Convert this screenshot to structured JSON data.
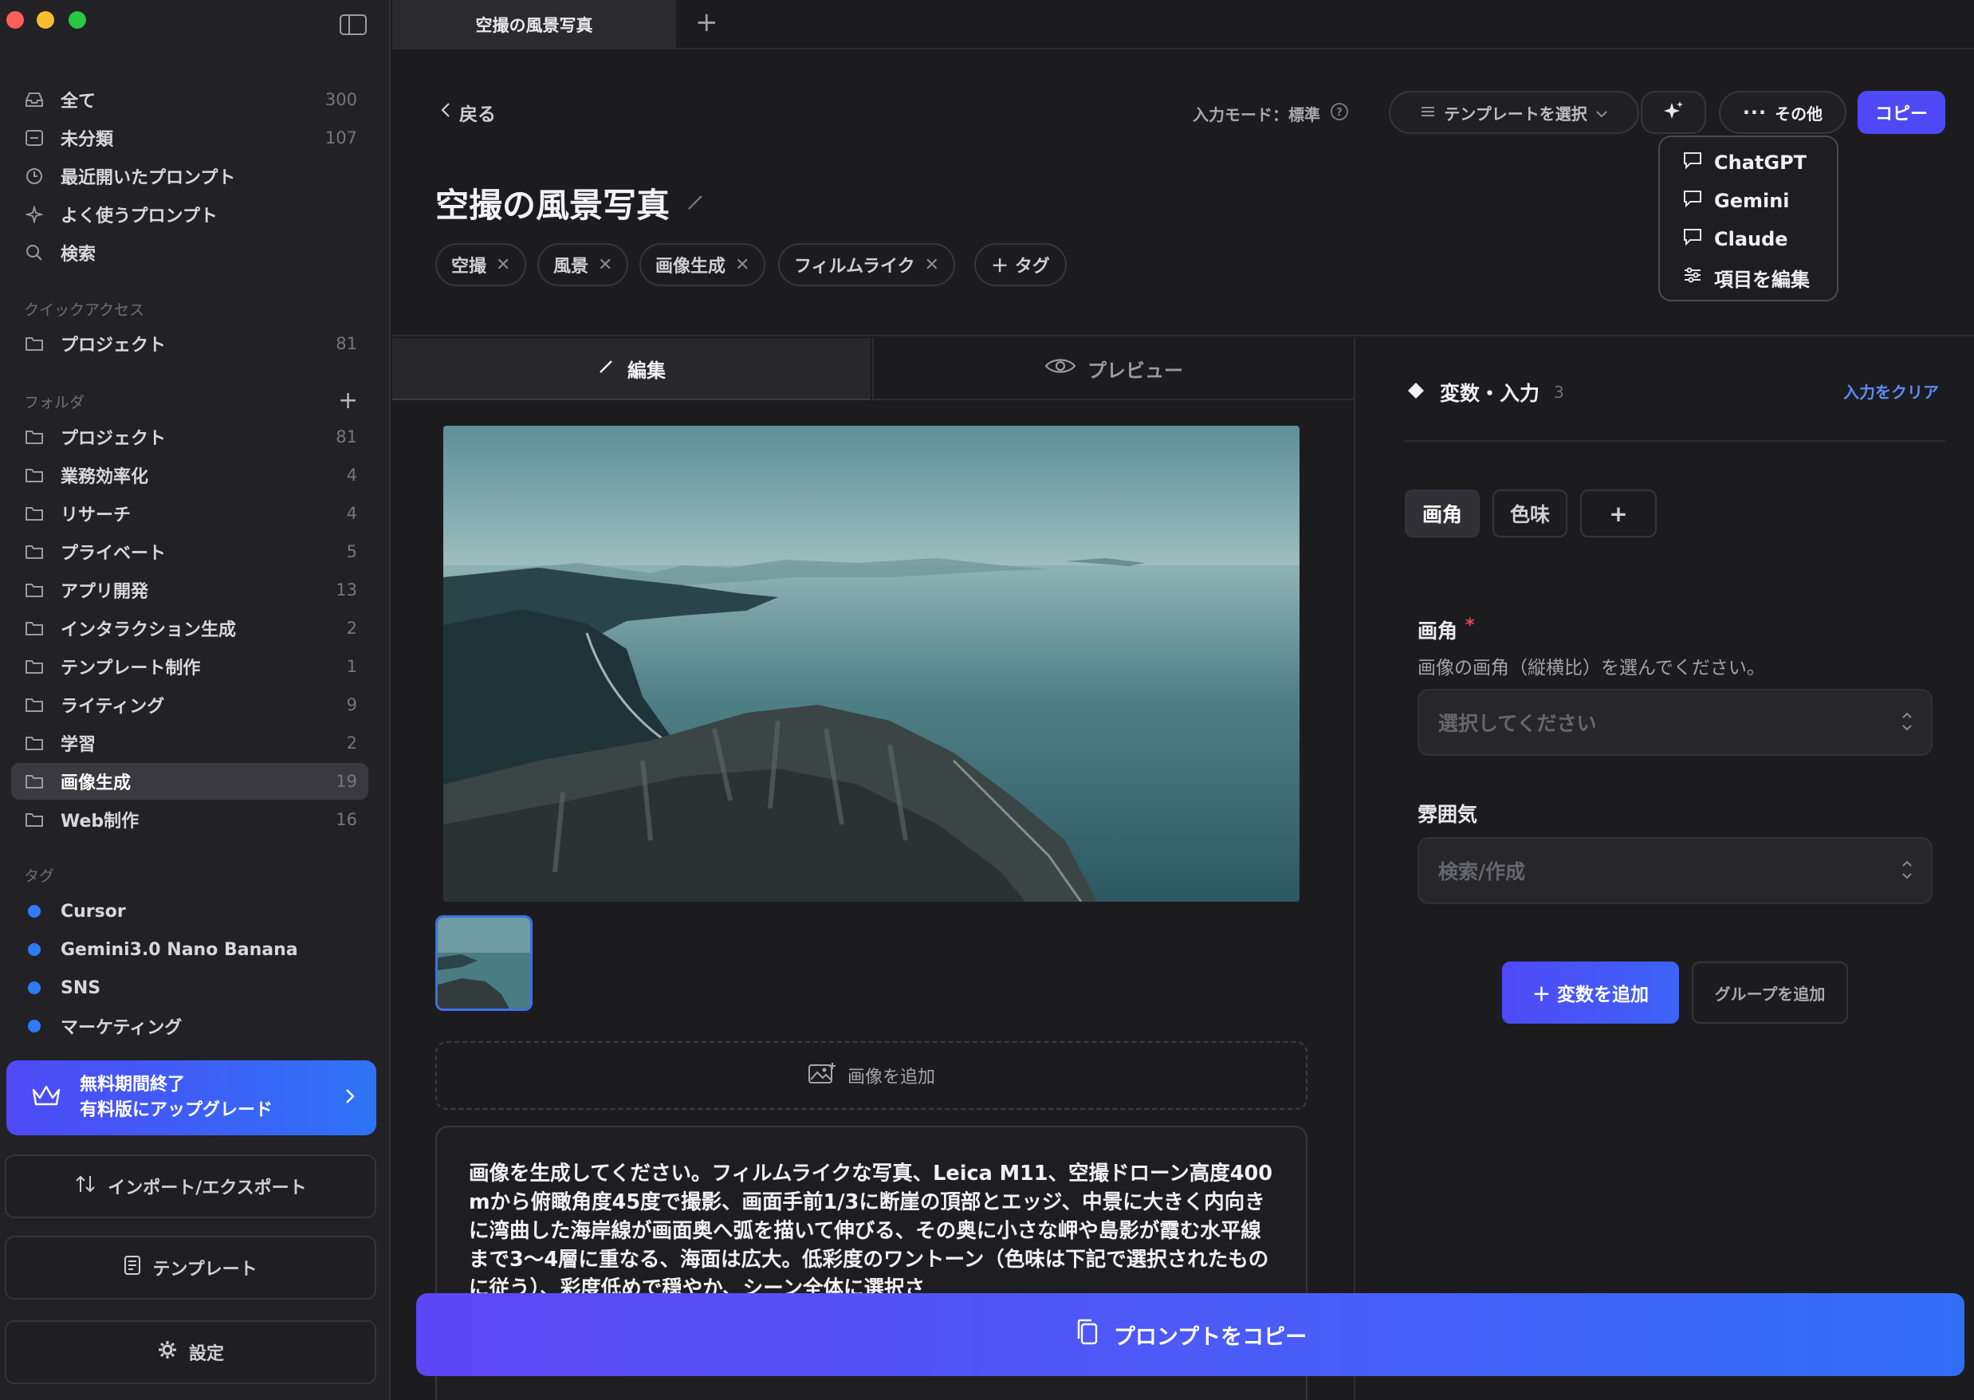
{
  "colors": {
    "accent": "#4f49f5",
    "accent_blue": "#316ef6",
    "required": "#e5484d",
    "tag_dot": "#2f7bf6",
    "link": "#5b8cf7"
  },
  "window": {
    "traffic_lights": [
      "close",
      "minimize",
      "zoom"
    ],
    "sidebar_toggle_icon": "sidebar-icon"
  },
  "sidebar": {
    "top_items": [
      {
        "label": "全て",
        "count": "300",
        "icon": "inbox-icon"
      },
      {
        "label": "未分類",
        "count": "107",
        "icon": "tray-icon"
      },
      {
        "label": "最近開いたプロンプト",
        "count": "",
        "icon": "clock-icon"
      },
      {
        "label": "よく使うプロンプト",
        "count": "",
        "icon": "sparkle-icon"
      },
      {
        "label": "検索",
        "count": "",
        "icon": "search-icon"
      }
    ],
    "quick_access_label": "クイックアクセス",
    "quick_access": [
      {
        "label": "プロジェクト",
        "count": "81"
      }
    ],
    "folders_label": "フォルダ",
    "folders": [
      {
        "label": "プロジェクト",
        "count": "81"
      },
      {
        "label": "業務効率化",
        "count": "4"
      },
      {
        "label": "リサーチ",
        "count": "4"
      },
      {
        "label": "プライベート",
        "count": "5"
      },
      {
        "label": "アプリ開発",
        "count": "13"
      },
      {
        "label": "インタラクション生成",
        "count": "2"
      },
      {
        "label": "テンプレート制作",
        "count": "1"
      },
      {
        "label": "ライティング",
        "count": "9"
      },
      {
        "label": "学習",
        "count": "2"
      },
      {
        "label": "画像生成",
        "count": "19"
      },
      {
        "label": "Web制作",
        "count": "16"
      }
    ],
    "active_folder": "画像生成",
    "tags_label": "タグ",
    "tags": [
      "Cursor",
      "Gemini3.0 Nano Banana",
      "SNS",
      "マーケティング"
    ],
    "upgrade": {
      "line1": "無料期間終了",
      "line2": "有料版にアップグレード"
    },
    "import_export": "インポート/エクスポート",
    "templates": "テンプレート",
    "settings": "設定"
  },
  "tabbar": {
    "tab_title": "空撮の風景写真",
    "new_tab": "+"
  },
  "toolbar": {
    "back": "戻る",
    "input_mode": "入力モード：標準",
    "template_select": "テンプレートを選択",
    "more": "その他",
    "copy": "コピー"
  },
  "dropdown": {
    "items": [
      "ChatGPT",
      "Gemini",
      "Claude",
      "項目を編集"
    ]
  },
  "prompt": {
    "title": "空撮の風景写真",
    "tags": [
      "空撮",
      "風景",
      "画像生成",
      "フィルムライク"
    ],
    "add_tag": "＋ タグ"
  },
  "editor": {
    "tab_edit": "編集",
    "tab_preview": "プレビュー",
    "active_tab": "編集",
    "add_image": "画像を追加",
    "body": "画像を生成してください。フィルムライクな写真、Leica M11、空撮ドローン高度400mから俯瞰角度45度で撮影、画面手前1/3に断崖の頂部とエッジ、中景に大きく内向きに湾曲した海岸線が画面奥へ弧を描いて伸びる、その奥に小さな岬や島影が霞む水平線まで3〜4層に重なる、海面は広大。低彩度のワントーン（色味は下記で選択されたものに従う）、彩度低めで穏やか、シーン全体に選択さ",
    "copy_prompt": "プロンプトをコピー"
  },
  "variables": {
    "header": "変数・入力",
    "count": "3",
    "clear": "入力をクリア",
    "chips": [
      "画角",
      "色味"
    ],
    "add_chip": "+",
    "active_chip": "画角",
    "field1": {
      "label": "画角",
      "required": "*",
      "description": "画像の画角（縦横比）を選んでください。",
      "placeholder": "選択してください"
    },
    "field2": {
      "label": "雰囲気",
      "placeholder": "検索/作成"
    },
    "add_variable": "＋ 変数を追加",
    "add_group": "グループを追加"
  }
}
